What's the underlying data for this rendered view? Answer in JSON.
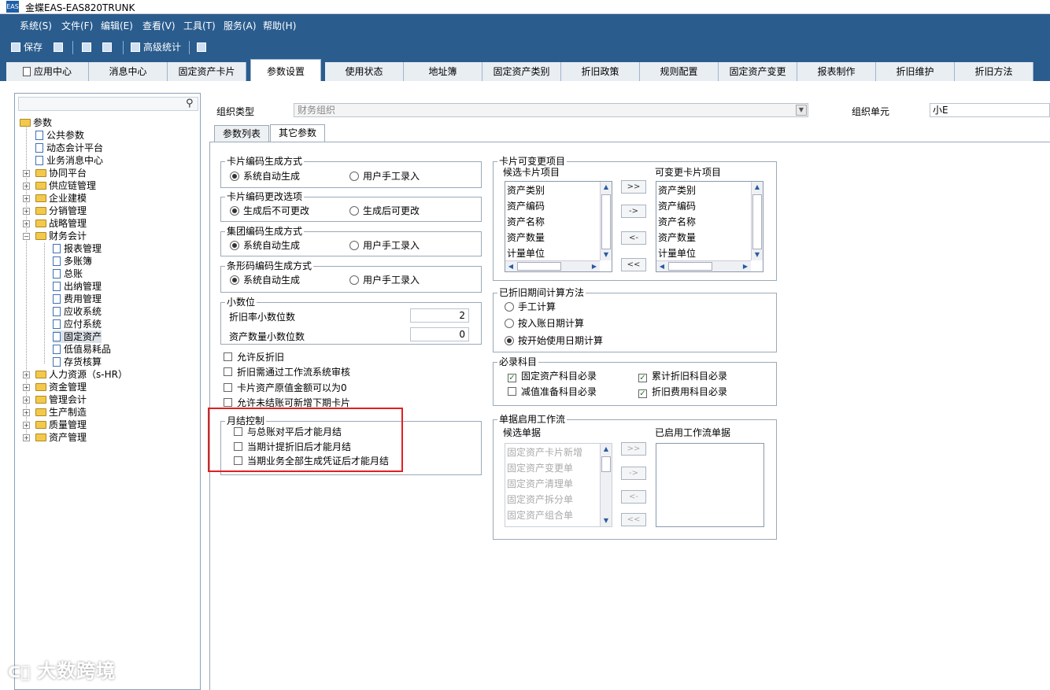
{
  "titlebar": {
    "logo": "EAS",
    "title": "金蝶EAS-EAS820TRUNK"
  },
  "menu": [
    "系统(S)",
    "文件(F)",
    "编辑(E)",
    "查看(V)",
    "工具(T)",
    "服务(A)",
    "帮助(H)"
  ],
  "toolbar": {
    "save": "保存",
    "advanced_stats": "高级统计"
  },
  "tabs": [
    "应用中心",
    "消息中心",
    "固定资产卡片",
    "参数设置",
    "使用状态",
    "地址簿",
    "固定资产类别",
    "折旧政策",
    "规则配置",
    "固定资产变更",
    "报表制作",
    "折旧维护",
    "折旧方法"
  ],
  "active_tab": "参数设置",
  "tree": {
    "root": "参数",
    "items": [
      "公共参数",
      "动态会计平台",
      "业务消息中心",
      "协同平台",
      "供应链管理",
      "企业建模",
      "分销管理",
      "战略管理",
      "财务会计",
      "报表管理",
      "多账簿",
      "总账",
      "出纳管理",
      "费用管理",
      "应收系统",
      "应付系统",
      "固定资产",
      "低值易耗品",
      "存货核算",
      "人力资源（s-HR）",
      "资金管理",
      "管理会计",
      "生产制造",
      "质量管理",
      "资产管理"
    ],
    "selected": "固定资产"
  },
  "org": {
    "type_label": "组织类型",
    "type_value": "财务组织",
    "unit_label": "组织单元",
    "unit_value": "小E"
  },
  "subtabs": [
    "参数列表",
    "其它参数"
  ],
  "card_code_gen": {
    "title": "卡片编码生成方式",
    "opt1": "系统自动生成",
    "opt2": "用户手工录入"
  },
  "card_code_change": {
    "title": "卡片编码更改选项",
    "opt1": "生成后不可更改",
    "opt2": "生成后可更改"
  },
  "group_code_gen": {
    "title": "集团编码生成方式",
    "opt1": "系统自动生成",
    "opt2": "用户手工录入"
  },
  "barcode_gen": {
    "title": "条形码编码生成方式",
    "opt1": "系统自动生成",
    "opt2": "用户手工录入"
  },
  "decimals": {
    "title": "小数位",
    "rate_label": "折旧率小数位数",
    "rate_value": "2",
    "qty_label": "资产数量小数位数",
    "qty_value": "0"
  },
  "checks": [
    "允许反折旧",
    "折旧需通过工作流系统审核",
    "卡片资产原值金额可以为0",
    "允许未结账可新增下期卡片"
  ],
  "month_end": {
    "title": "月结控制",
    "items": [
      "与总账对平后才能月结",
      "当期计提折旧后才能月结",
      "当期业务全部生成凭证后才能月结"
    ]
  },
  "card_change": {
    "title": "卡片可变更项目",
    "cand_label": "候选卡片项目",
    "chg_label": "可变更卡片项目",
    "cand_items": [
      "资产类别",
      "资产编码",
      "资产名称",
      "资产数量",
      "计量单位"
    ],
    "chg_items": [
      "资产类别",
      "资产编码",
      "资产名称",
      "资产数量",
      "计量单位"
    ]
  },
  "move_buttons": [
    ">>",
    "->",
    "<-",
    "<<"
  ],
  "depr_calc": {
    "title": "已折旧期间计算方法",
    "opt1": "手工计算",
    "opt2": "按入账日期计算",
    "opt3": "按开始使用日期计算"
  },
  "required": {
    "title": "必录科目",
    "a": "固定资产科目必录",
    "b": "累计折旧科目必录",
    "c": "减值准备科目必录",
    "d": "折旧费用科目必录"
  },
  "workflow": {
    "title": "单据启用工作流",
    "cand_label": "候选单据",
    "enabled_label": "已启用工作流单据",
    "cand_items": [
      "固定资产卡片新增",
      "固定资产变更单",
      "固定资产清理单",
      "固定资产拆分单",
      "固定资产组合单"
    ]
  },
  "watermark": "大数跨境"
}
